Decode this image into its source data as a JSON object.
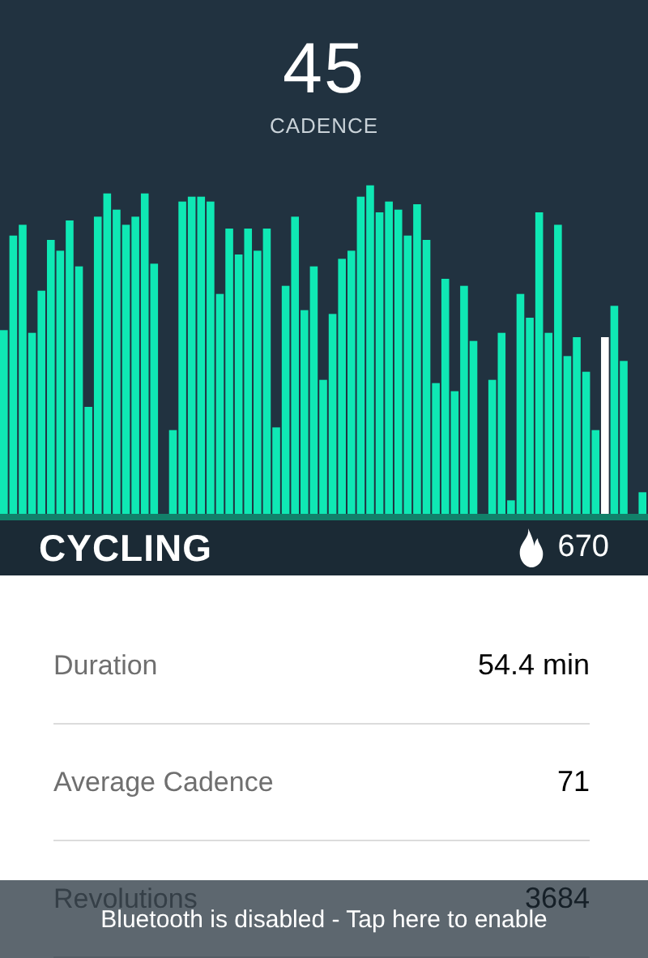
{
  "header": {
    "value": "45",
    "label": "CADENCE"
  },
  "activity": {
    "name": "CYCLING",
    "calories": "670"
  },
  "stats": [
    {
      "label": "Duration",
      "value": "54.4 min"
    },
    {
      "label": "Average Cadence",
      "value": "71"
    },
    {
      "label": "Revolutions",
      "value": "3684"
    }
  ],
  "toast": {
    "text": "Bluetooth is disabled - Tap here to enable"
  }
}
